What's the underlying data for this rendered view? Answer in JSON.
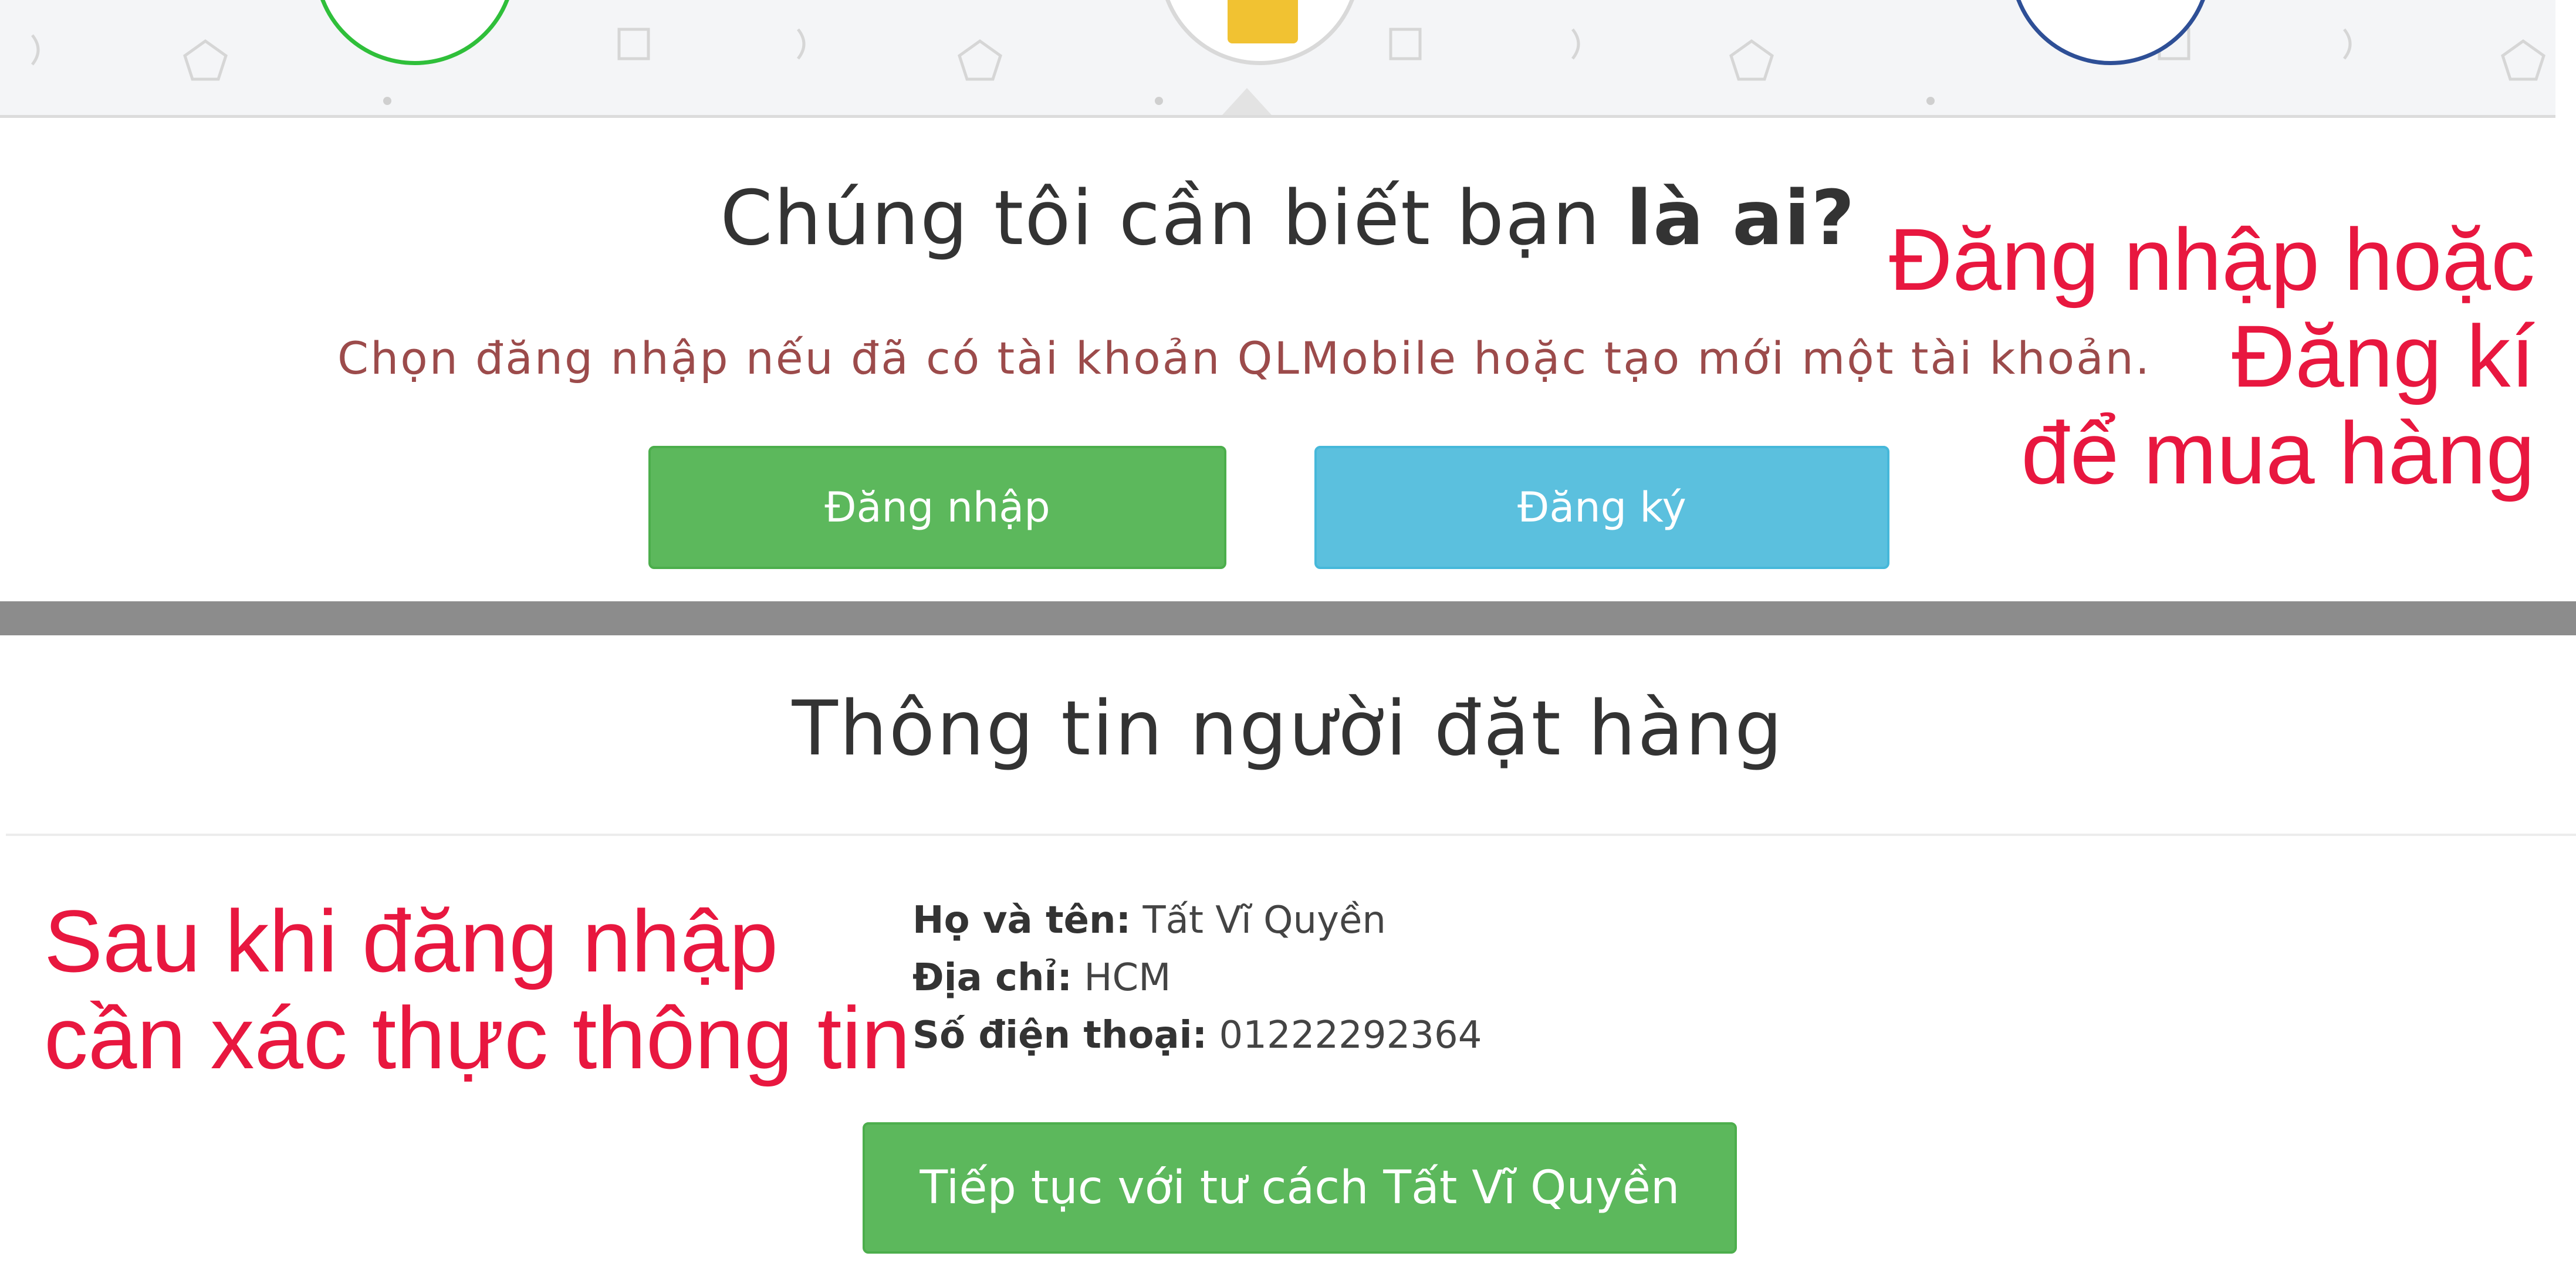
{
  "login_prompt": {
    "title_regular": "Chúng tôi cần biết bạn",
    "title_bold": "là ai?",
    "subtitle": "Chọn đăng nhập nếu đã có tài khoản QLMobile hoặc tạo mới một tài khoản.",
    "login_button": "Đăng nhập",
    "register_button": "Đăng ký"
  },
  "annotations": {
    "top": [
      "Đăng nhập hoặc",
      "Đăng kí",
      "để mua hàng"
    ],
    "bottom": [
      "Sau khi đăng nhập",
      "cần xác thực thông tin"
    ]
  },
  "order_info": {
    "title": "Thông tin người đặt hàng",
    "fields": [
      {
        "label": "Họ và tên:",
        "value": "Tất Vĩ Quyền"
      },
      {
        "label": "Địa chỉ:",
        "value": "HCM"
      },
      {
        "label": "Số điện thoại:",
        "value": "01222292364"
      }
    ],
    "continue_button": "Tiếp tục với tư cách Tất Vĩ Quyền"
  },
  "colors": {
    "success_green": "#5cb85c",
    "info_blue": "#5bc0de",
    "annotation_red": "#e8173f",
    "step1_ring": "#2fbf3a",
    "step3_ring": "#2e4f96"
  }
}
